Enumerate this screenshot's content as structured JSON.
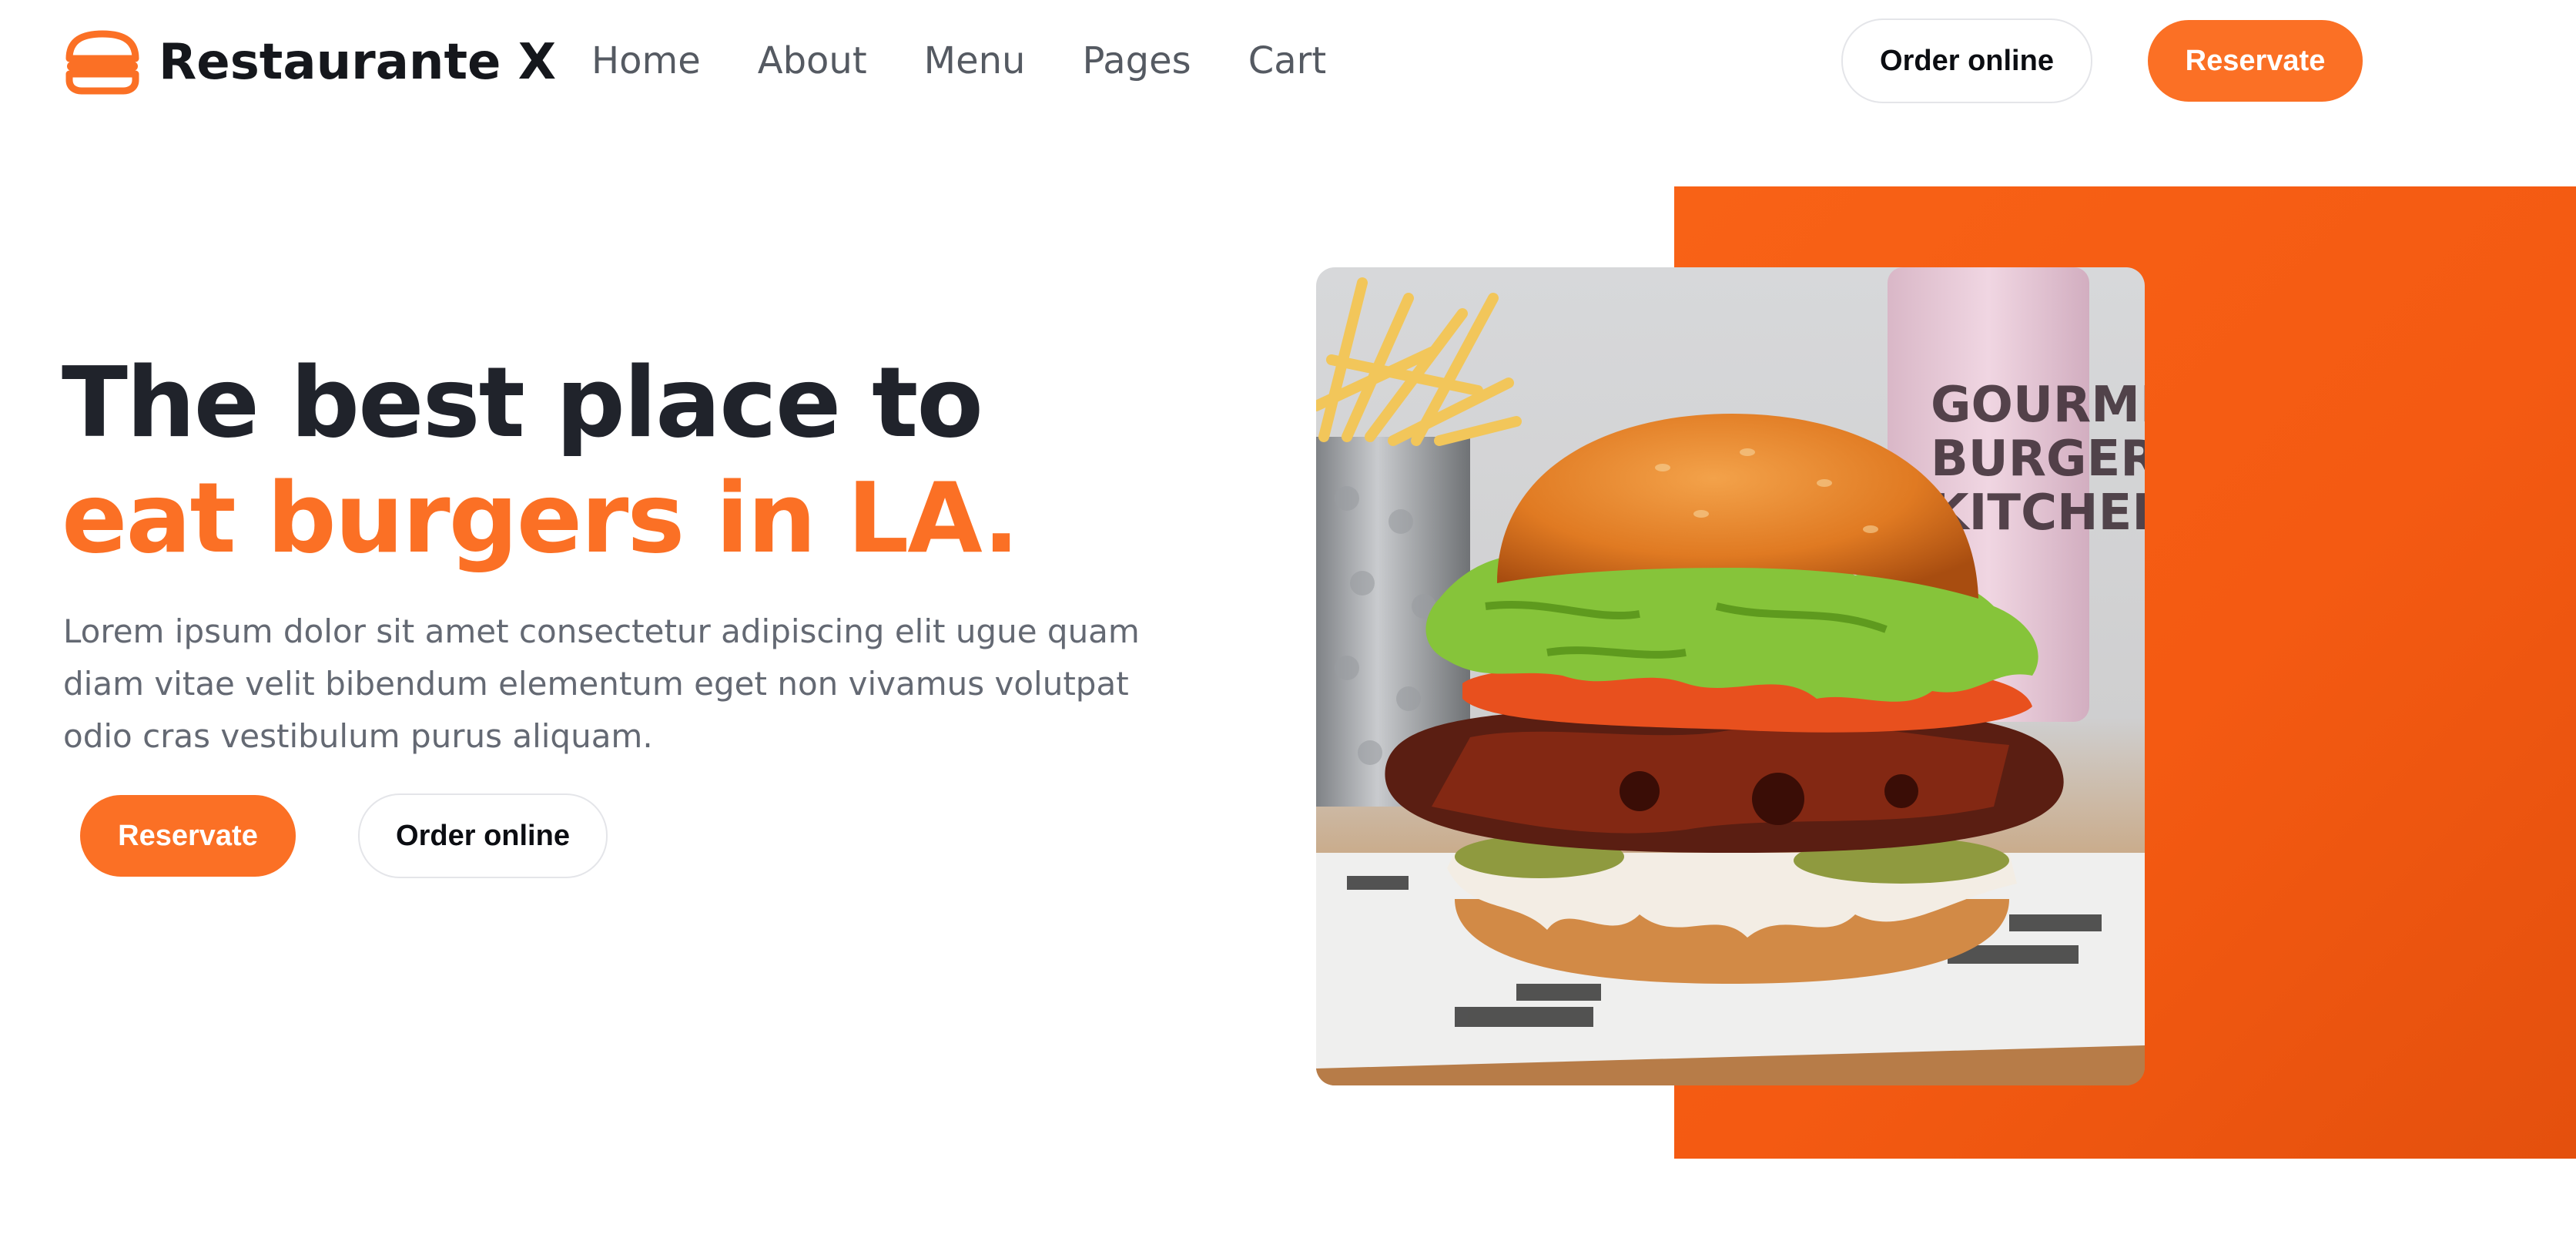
{
  "header": {
    "brand_name": "Restaurante X",
    "logo_icon": "burger-icon",
    "nav": [
      {
        "label": "Home"
      },
      {
        "label": "About"
      },
      {
        "label": "Menu"
      },
      {
        "label": "Pages"
      },
      {
        "label": "Cart"
      }
    ],
    "order_label": "Order online",
    "reserve_label": "Reservate"
  },
  "hero": {
    "title_line1": "The best place to",
    "title_line2": "eat burgers in LA.",
    "description": "Lorem ipsum dolor sit amet consectetur adipiscing elit ugue quam diam vitae velit bibendum elementum eget non vivamus volutpat odio cras vestibulum purus aliquam.",
    "reserve_label": "Reservate",
    "order_label": "Order online",
    "cup_print": [
      "GOURMET",
      "BURGER",
      "KITCHEN"
    ]
  },
  "colors": {
    "accent": "#fb7025",
    "panel": "#f45a12",
    "heading": "#20232b",
    "body_text": "#646973"
  }
}
